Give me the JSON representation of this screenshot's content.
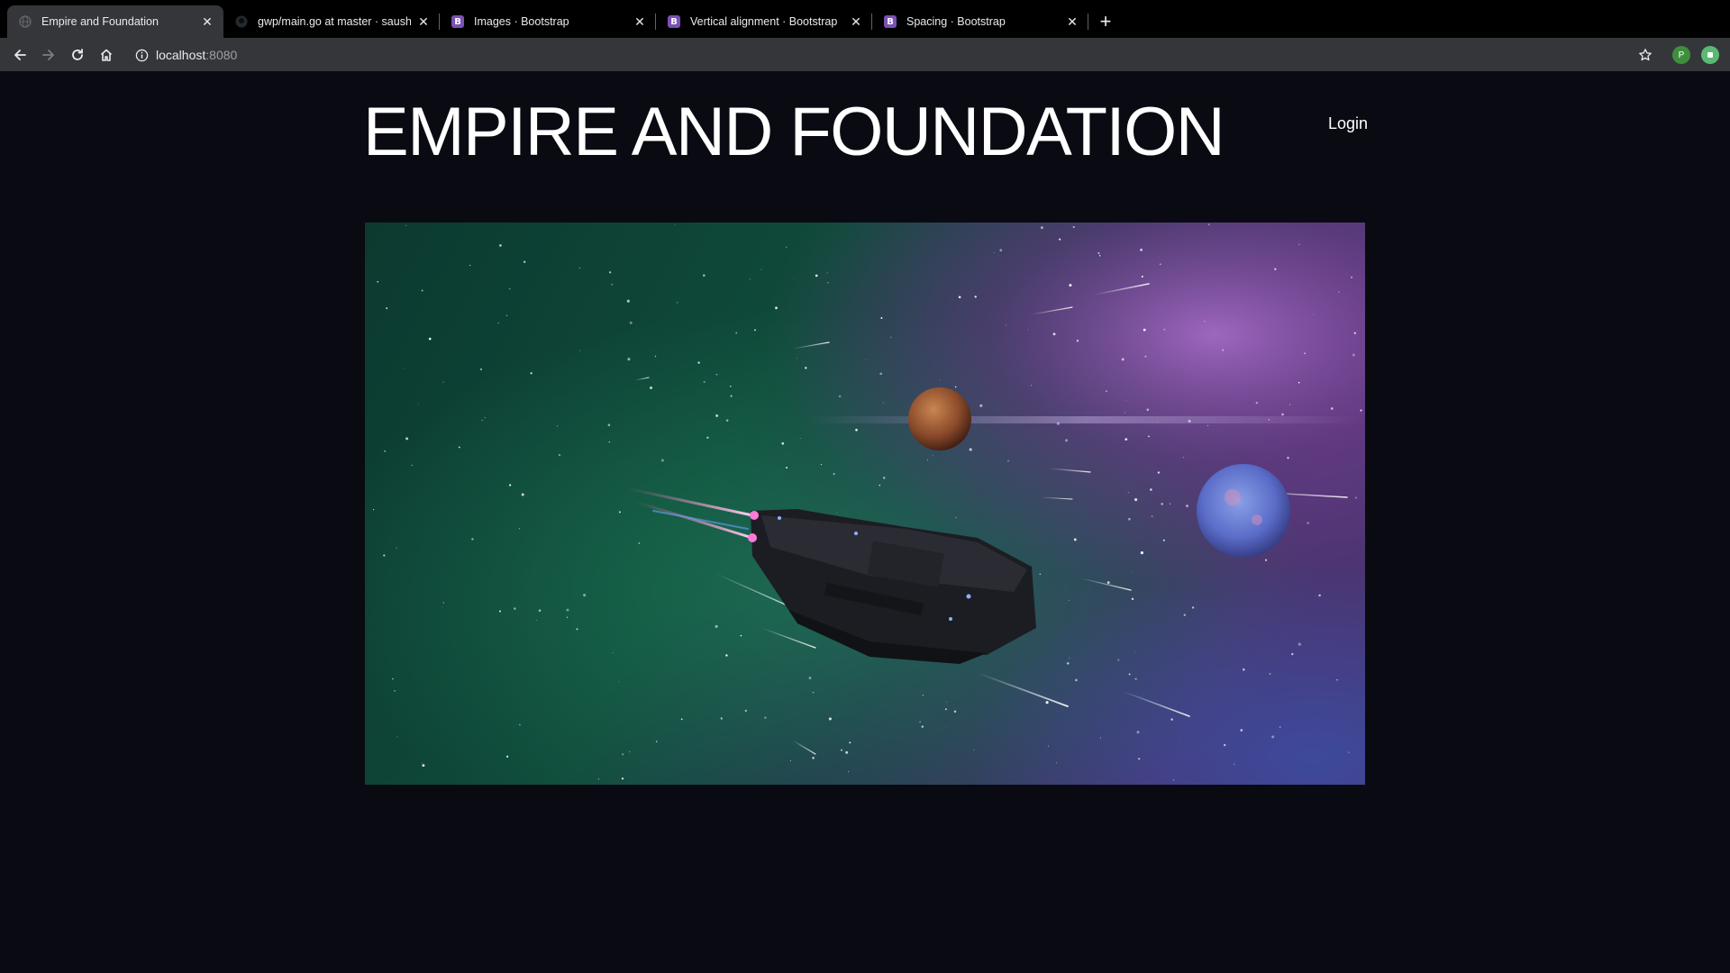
{
  "browser": {
    "tabs": [
      {
        "title": "Empire and Foundation",
        "favicon": "globe-icon",
        "active": true
      },
      {
        "title": "gwp/main.go at master · saush",
        "favicon": "github-icon",
        "active": false
      },
      {
        "title": "Images · Bootstrap",
        "favicon": "bootstrap-icon",
        "active": false
      },
      {
        "title": "Vertical alignment · Bootstrap",
        "favicon": "bootstrap-icon",
        "active": false
      },
      {
        "title": "Spacing · Bootstrap",
        "favicon": "bootstrap-icon",
        "active": false
      }
    ],
    "bootstrap_favicon_letter": "B",
    "address": {
      "host": "localhost",
      "port": ":8080"
    },
    "profile_initial": "P",
    "colors": {
      "tabstrip": "#000000",
      "toolbar": "#35363a",
      "profile": "#3d8f3d",
      "extension": "#5bb974",
      "bootstrap": "#7952b3"
    }
  },
  "page": {
    "title": "EMPIRE AND FOUNDATION",
    "login": "Login",
    "hero_image": "space-scene-image"
  },
  "colors": {
    "page_background": "#0a0b12",
    "text": "#ffffff"
  }
}
